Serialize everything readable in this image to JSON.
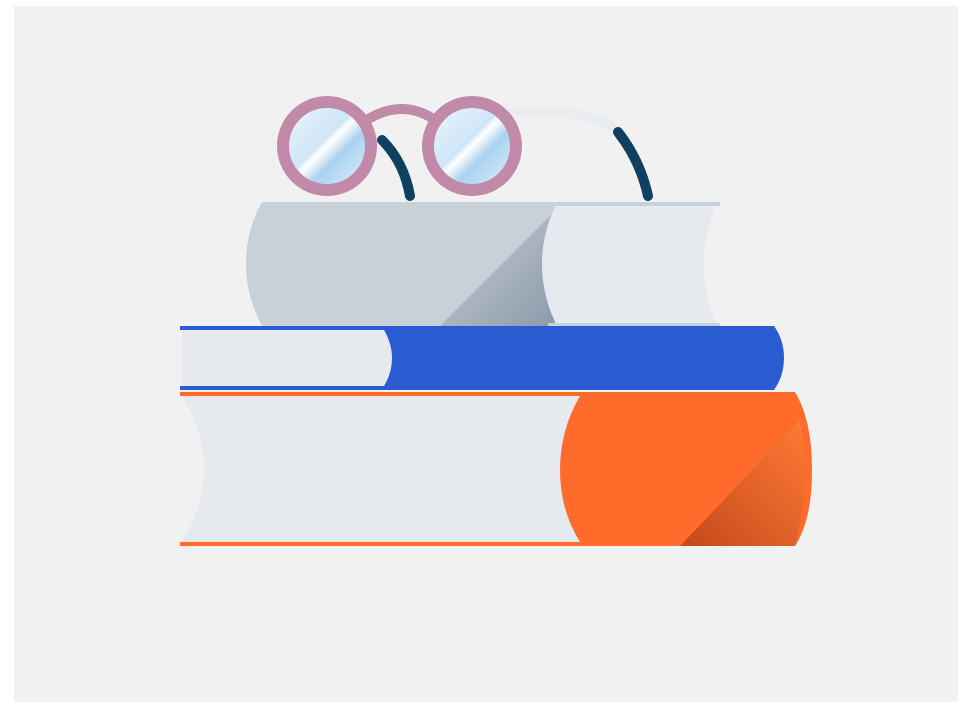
{
  "illustration": {
    "subject": "stack-of-books-with-glasses",
    "colors": {
      "background": "#f1f1f1",
      "page_light": "#e6eaee",
      "cover_grey": "#c8d0d8",
      "cover_grey_shadow": "#9eaab8",
      "cover_blue": "#2a5bd1",
      "cover_orange": "#ff6b2b",
      "cover_orange_shadow": "#d9521a",
      "glasses_frame": "#c08aa8",
      "glasses_temple": "#0f4060",
      "lens_light": "#dcefff",
      "lens_tint": "#a9d2ef"
    }
  }
}
